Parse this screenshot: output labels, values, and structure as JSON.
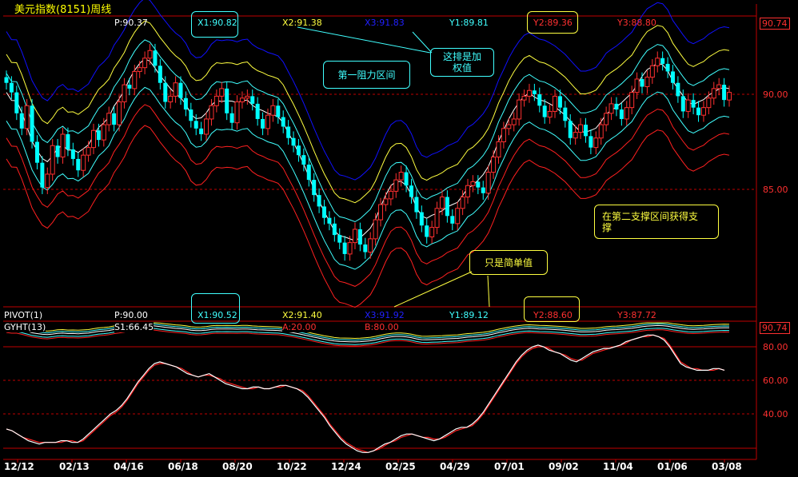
{
  "title": "美元指数(8151)周线",
  "header_top": {
    "p": "P:90.37",
    "x1": "X1:90.82",
    "x2": "X2:91.38",
    "x3": "X3:91.83",
    "y1": "Y1:89.81",
    "y2": "Y2:89.36",
    "y3": "Y3:88.80"
  },
  "header_mid": {
    "name": "PIVOT(1)",
    "p": "P:90.00",
    "x1": "X1:90.52",
    "x2": "X2:91.40",
    "x3": "X3:91.92",
    "y1": "Y1:89.12",
    "y2": "Y2:88.60",
    "y3": "Y3:87.72"
  },
  "header_low": {
    "name": "GYHT(13)",
    "s": "S1:66.45",
    "a": "A:20.00",
    "b": "B:80.00"
  },
  "annotations": {
    "resistance": "第一阻力区间",
    "weighted_line1": "这排是加",
    "weighted_line2": "权值",
    "simple": "只是简单值",
    "support_line1": "在第二支撑区间获得支",
    "support_line2": "撑"
  },
  "right_axis": {
    "top_value": "90.74",
    "t90": "90.00",
    "t85": "85.00",
    "mid_value": "90.74",
    "o80": "80.00",
    "o60": "60.00",
    "o40": "40.00"
  },
  "colors": {
    "background": "#000000",
    "up": "#ff3030",
    "down": "#00ffff",
    "band_blue": "#1010ff",
    "band_yellow": "#ffff40",
    "band_cyan": "#40ffff",
    "band_red": "#ff2020",
    "osc_fast": "#ffffff",
    "osc_slow": "#ff2020",
    "grid": "#c00000"
  },
  "chart_data": {
    "type": "candlestick",
    "title": "美元指数(8151)周线",
    "x_tick_labels": [
      "12/12",
      "02/13",
      "04/16",
      "06/18",
      "08/20",
      "10/22",
      "12/24",
      "02/25",
      "04/29",
      "07/01",
      "09/02",
      "11/04",
      "01/06",
      "03/08"
    ],
    "price_axis": {
      "ticks": [
        85.0,
        90.0
      ],
      "ylim": [
        81.0,
        94.5
      ]
    },
    "price_close": [
      90.6,
      90.1,
      89.0,
      88.2,
      89.4,
      87.5,
      86.4,
      85.1,
      85.8,
      87.3,
      86.7,
      87.9,
      87.1,
      86.6,
      86.0,
      86.8,
      87.2,
      88.1,
      87.6,
      88.4,
      89.0,
      88.4,
      89.6,
      90.5,
      90.3,
      91.2,
      91.4,
      91.9,
      92.3,
      91.5,
      90.6,
      89.6,
      89.9,
      90.6,
      89.8,
      89.2,
      88.6,
      88.2,
      87.9,
      88.7,
      89.4,
      89.9,
      90.3,
      89.0,
      88.5,
      89.6,
      89.8,
      89.9,
      89.5,
      88.7,
      88.2,
      88.9,
      89.4,
      88.8,
      88.3,
      87.7,
      87.3,
      86.8,
      86.3,
      85.5,
      84.7,
      84.1,
      83.5,
      83.2,
      82.6,
      82.2,
      81.6,
      82.2,
      82.9,
      82.1,
      81.7,
      82.4,
      83.4,
      84.2,
      84.5,
      84.9,
      85.5,
      85.9,
      85.2,
      84.6,
      83.8,
      83.1,
      82.5,
      83.0,
      84.0,
      84.6,
      83.6,
      83.2,
      84.0,
      84.6,
      85.2,
      85.4,
      85.1,
      84.8,
      85.9,
      86.7,
      87.5,
      88.2,
      88.4,
      88.7,
      89.7,
      89.9,
      90.2,
      90.0,
      89.4,
      88.8,
      89.1,
      89.9,
      89.3,
      88.6,
      87.7,
      88.0,
      88.4,
      87.8,
      87.2,
      87.7,
      88.4,
      89.0,
      89.5,
      89.2,
      88.7,
      89.3,
      90.1,
      90.8,
      90.4,
      90.9,
      91.5,
      91.9,
      91.6,
      91.2,
      90.6,
      89.9,
      89.1,
      89.7,
      89.3,
      88.9,
      89.3,
      89.8,
      90.3,
      90.5,
      89.7,
      90.1
    ],
    "oscillator": {
      "name": "GYHT(13)",
      "ticks": [
        40,
        60,
        80
      ],
      "ylim": [
        0,
        100
      ],
      "fast": [
        31,
        30,
        28,
        26,
        24,
        23,
        22,
        23,
        23,
        23,
        24,
        24,
        23,
        23,
        25,
        28,
        31,
        34,
        37,
        40,
        42,
        45,
        49,
        54,
        59,
        63,
        67,
        70,
        71,
        70,
        69,
        68,
        66,
        64,
        63,
        62,
        63,
        64,
        62,
        60,
        58,
        57,
        56,
        55,
        55,
        56,
        56,
        55,
        55,
        56,
        57,
        57,
        56,
        55,
        53,
        50,
        46,
        42,
        38,
        33,
        29,
        25,
        22,
        20,
        18,
        17,
        17,
        18,
        20,
        22,
        23,
        25,
        27,
        28,
        28,
        27,
        26,
        25,
        24,
        25,
        27,
        29,
        31,
        32,
        32,
        34,
        37,
        41,
        46,
        51,
        56,
        61,
        66,
        71,
        75,
        78,
        80,
        81,
        80,
        78,
        77,
        76,
        74,
        72,
        71,
        73,
        75,
        77,
        78,
        79,
        79,
        80,
        81,
        83,
        84,
        85,
        86,
        87,
        87,
        86,
        84,
        80,
        75,
        70,
        68,
        67,
        66,
        66,
        66,
        67,
        67,
        66
      ],
      "slow": [
        31,
        30,
        28,
        26,
        25,
        24,
        23,
        23,
        23,
        23,
        23,
        24,
        24,
        23,
        24,
        27,
        30,
        33,
        36,
        39,
        41,
        44,
        48,
        53,
        58,
        62,
        66,
        69,
        70,
        70,
        69,
        68,
        67,
        65,
        63,
        62,
        63,
        63,
        62,
        61,
        59,
        58,
        57,
        56,
        55,
        55,
        56,
        55,
        55,
        56,
        56,
        57,
        56,
        55,
        54,
        51,
        47,
        43,
        39,
        34,
        30,
        26,
        23,
        21,
        19,
        18,
        17,
        18,
        19,
        21,
        23,
        24,
        26,
        27,
        28,
        27,
        26,
        26,
        25,
        25,
        26,
        28,
        30,
        31,
        32,
        33,
        36,
        40,
        45,
        50,
        55,
        60,
        65,
        70,
        74,
        77,
        79,
        80,
        80,
        79,
        77,
        76,
        75,
        73,
        72,
        72,
        74,
        76,
        77,
        78,
        79,
        80,
        81,
        82,
        84,
        85,
        86,
        86,
        87,
        86,
        85,
        81,
        76,
        71,
        69,
        67,
        67,
        66,
        66,
        66,
        67,
        66
      ]
    }
  }
}
